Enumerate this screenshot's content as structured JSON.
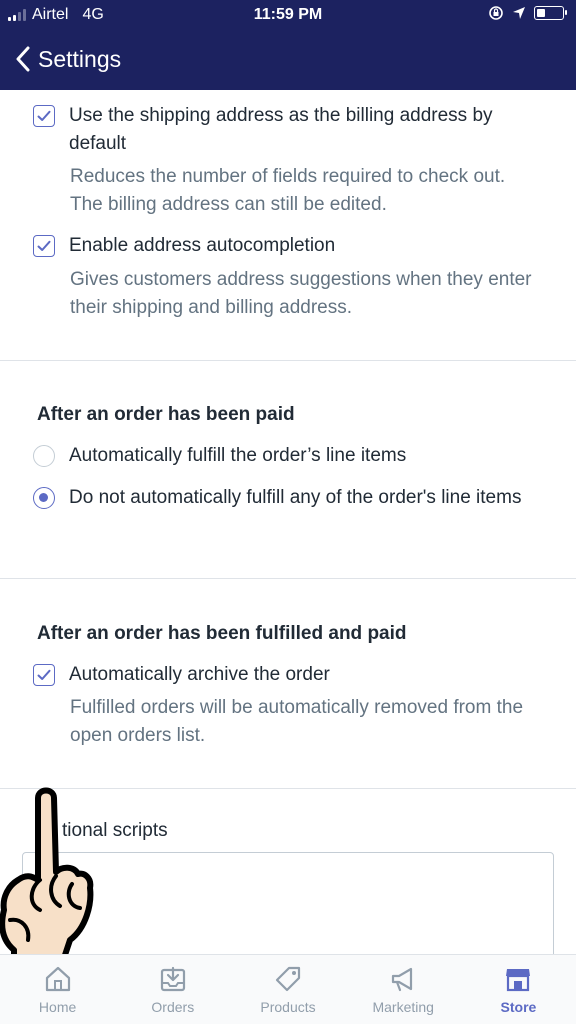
{
  "status_bar": {
    "carrier": "Airtel",
    "network": "4G",
    "time": "11:59 PM",
    "battery_level": 0.35
  },
  "nav": {
    "back_label": "Settings"
  },
  "checkout": {
    "billing_option": {
      "label": "Use the shipping address as the billing address by default",
      "help": "Reduces the number of fields required to check out. The billing address can still be edited.",
      "checked": true
    },
    "autocomplete_option": {
      "label": "Enable address autocompletion",
      "help": "Gives customers address suggestions when they enter their shipping and billing address.",
      "checked": true
    }
  },
  "paid_section": {
    "heading": "After an order has been paid",
    "options": [
      {
        "label": "Automatically fulfill the order’s line items",
        "selected": false
      },
      {
        "label": "Do not automatically fulfill any of the order's line items",
        "selected": true
      }
    ]
  },
  "fulfilled_section": {
    "heading": "After an order has been fulfilled and paid",
    "archive_option": {
      "label": "Automatically archive the order",
      "help": "Fulfilled orders will be automatically removed from the open orders list.",
      "checked": true
    }
  },
  "scripts_section": {
    "label": "Additional scripts",
    "visible_label": "tional scripts"
  },
  "tabs": [
    {
      "label": "Home",
      "icon": "home-icon",
      "active": false
    },
    {
      "label": "Orders",
      "icon": "orders-icon",
      "active": false
    },
    {
      "label": "Products",
      "icon": "tag-icon",
      "active": false
    },
    {
      "label": "Marketing",
      "icon": "megaphone-icon",
      "active": false
    },
    {
      "label": "Store",
      "icon": "store-icon",
      "active": true
    }
  ],
  "colors": {
    "header_bg": "#1c2260",
    "accent": "#5c6ac4",
    "help_text": "#637381",
    "tab_inactive": "#919eab"
  }
}
